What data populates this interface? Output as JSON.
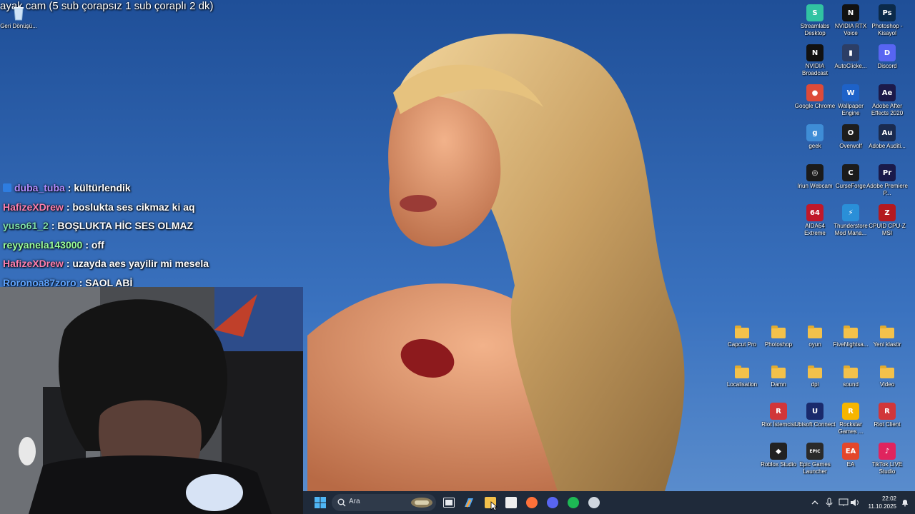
{
  "stream_title": "ayak cam (5 sub çorapsız 1 sub çoraplı 2 dk)",
  "chat": [
    {
      "user": "duba_tuba",
      "message": ": kültürlendik",
      "color": "#b28cff"
    },
    {
      "user": "HafizeXDrew",
      "message": ": boslukta ses cikmaz ki aq",
      "color": "#ff7fae"
    },
    {
      "user": "yuso61_2",
      "message": ": BOŞLUKTA HİC SES OLMAZ",
      "color": "#7fe0a8"
    },
    {
      "user": "reyyanela143000",
      "message": ": off",
      "color": "#9aff9a"
    },
    {
      "user": "HafizeXDrew",
      "message": ": uzayda aes yayilir mi mesela",
      "color": "#ff7fae"
    },
    {
      "user": "Roronoa87zoro",
      "message": ": SAOL ABİ",
      "color": "#5fa4ff"
    }
  ],
  "desktop": {
    "recycle_bin": "Geri Dönüşü...",
    "icons": [
      {
        "label": "Streamlabs Desktop",
        "icon": "streamlabs-icon",
        "color": "#31c3a2",
        "glyph": "S"
      },
      {
        "label": "NVIDIA RTX Voice",
        "icon": "nvidia-rtx-voice-icon",
        "color": "#111111",
        "glyph": "N"
      },
      {
        "label": "Photoshop - Kisayol",
        "icon": "photoshop-icon",
        "color": "#0b2a4a",
        "glyph": "Ps"
      },
      {
        "label": "NVIDIA Broadcast",
        "icon": "nvidia-broadcast-icon",
        "color": "#111111",
        "glyph": "N"
      },
      {
        "label": "AutoClicke...",
        "icon": "autoclicker-icon",
        "color": "#2c3e66",
        "glyph": "▮"
      },
      {
        "label": "Discord",
        "icon": "discord-icon",
        "color": "#5865f2",
        "glyph": "D"
      },
      {
        "label": "Google Chrome",
        "icon": "chrome-icon",
        "color": "#dd4b39",
        "glyph": "●"
      },
      {
        "label": "Wallpaper Engine",
        "icon": "wallpaper-engine-icon",
        "color": "#1e62c8",
        "glyph": "W"
      },
      {
        "label": "Adobe After Effects 2020",
        "icon": "after-effects-icon",
        "color": "#1c1a4a",
        "glyph": "Ae"
      },
      {
        "label": "geek",
        "icon": "geek-icon",
        "color": "#3f8dd6",
        "glyph": "g"
      },
      {
        "label": "Overwolf",
        "icon": "overwolf-icon",
        "color": "#1d1d1d",
        "glyph": "O"
      },
      {
        "label": "Adobe Auditi...",
        "icon": "audition-icon",
        "color": "#1a2b4f",
        "glyph": "Au"
      },
      {
        "label": "Iriun Webcam",
        "icon": "iriun-webcam-icon",
        "color": "#1b1b1b",
        "glyph": "◎"
      },
      {
        "label": "CurseForge",
        "icon": "curseforge-icon",
        "color": "#1b1b1b",
        "glyph": "C"
      },
      {
        "label": "Adobe Premiere P...",
        "icon": "premiere-icon",
        "color": "#1a1a4a",
        "glyph": "Pr"
      },
      {
        "label": "AIDA64 Extreme",
        "icon": "aida64-icon",
        "color": "#c0182a",
        "glyph": "64"
      },
      {
        "label": "Thunderstore Mod Mana...",
        "icon": "thunderstore-icon",
        "color": "#2a8fd8",
        "glyph": "⚡"
      },
      {
        "label": "CPUID CPU-Z MSI",
        "icon": "cpuz-icon",
        "color": "#b4191f",
        "glyph": "Z"
      },
      {
        "label": "Capcut Pro",
        "icon": "folder-icon",
        "folder": true
      },
      {
        "label": "Photoshop",
        "icon": "folder-icon",
        "folder": true
      },
      {
        "label": "oyun",
        "icon": "folder-icon",
        "folder": true
      },
      {
        "label": "FiveNightsa...",
        "icon": "folder-icon",
        "folder": true
      },
      {
        "label": "Yeni klasör",
        "icon": "folder-icon",
        "folder": true
      },
      {
        "label": "Localisation",
        "icon": "folder-icon",
        "folder": true
      },
      {
        "label": "Damn",
        "icon": "folder-icon",
        "folder": true
      },
      {
        "label": "dpi",
        "icon": "folder-icon",
        "folder": true
      },
      {
        "label": "sound",
        "icon": "folder-icon",
        "folder": true
      },
      {
        "label": "Video",
        "icon": "folder-icon",
        "folder": true
      },
      {
        "label": "Riot İstemcisi",
        "icon": "riot-icon",
        "color": "#d13639",
        "glyph": "R"
      },
      {
        "label": "Ubisoft Connect",
        "icon": "ubisoft-icon",
        "color": "#1a2a6c",
        "glyph": "U"
      },
      {
        "label": "Rockstar Games ...",
        "icon": "rockstar-icon",
        "color": "#f6b500",
        "glyph": "R"
      },
      {
        "label": "Riot Client",
        "icon": "riot-client-icon",
        "color": "#d13639",
        "glyph": "R"
      },
      {
        "label": "Roblox Studio",
        "icon": "roblox-studio-icon",
        "color": "#222222",
        "glyph": "◆"
      },
      {
        "label": "Epic Games Launcher",
        "icon": "epic-games-icon",
        "color": "#2a2a2a",
        "glyph": "EPIC"
      },
      {
        "label": "EA",
        "icon": "ea-icon",
        "color": "#e4472b",
        "glyph": "EA"
      },
      {
        "label": "TikTok LIVE Studio",
        "icon": "tiktok-live-icon",
        "color": "#e0245e",
        "glyph": "♪"
      }
    ]
  },
  "taskbar": {
    "search_placeholder": "Ara",
    "time": "22:02",
    "date": "11.10.2025",
    "apps": [
      {
        "icon": "file-explorer-icon",
        "color": "#f3c14b"
      },
      {
        "icon": "store-icon",
        "color": "#eeeeee"
      },
      {
        "icon": "firefox-icon",
        "color": "#ff7139"
      },
      {
        "icon": "discord-icon",
        "color": "#5865f2"
      },
      {
        "icon": "spotify-icon",
        "color": "#1db954"
      },
      {
        "icon": "clock-app-icon",
        "color": "#cfd6df"
      }
    ]
  }
}
